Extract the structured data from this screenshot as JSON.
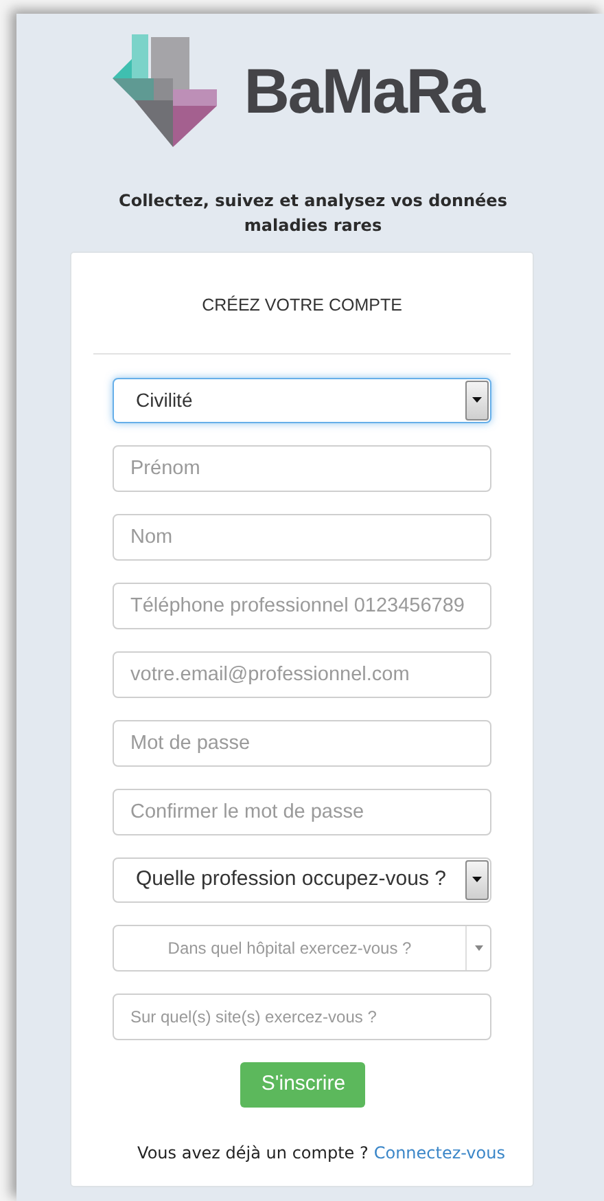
{
  "logo": {
    "text": "BaMaRa"
  },
  "tagline": "Collectez, suivez et analysez vos données maladies rares",
  "card": {
    "title": "CRÉEZ VOTRE COMPTE",
    "fields": [
      {
        "kind": "select",
        "value": "Civilité",
        "focused": true
      },
      {
        "kind": "input",
        "placeholder": "Prénom",
        "focused": false
      },
      {
        "kind": "input",
        "placeholder": "Nom",
        "focused": false
      },
      {
        "kind": "input",
        "placeholder": "Téléphone professionnel 0123456789",
        "focused": false
      },
      {
        "kind": "input",
        "placeholder": "votre.email@professionnel.com",
        "focused": false
      },
      {
        "kind": "input",
        "placeholder": "Mot de passe",
        "focused": false
      },
      {
        "kind": "input",
        "placeholder": "Confirmer le mot de passe",
        "focused": false
      },
      {
        "kind": "select",
        "value": "Quelle profession occupez-vous ?",
        "focused": false
      },
      {
        "kind": "combo",
        "placeholder": "Dans quel hôpital exercez-vous ?",
        "focused": false
      },
      {
        "kind": "tags",
        "placeholder": "Sur quel(s) site(s) exercez-vous ?",
        "focused": false
      }
    ],
    "submit": "S'inscrire",
    "footer": {
      "text": "Vous avez déjà un compte ?",
      "link": "Connectez-vous"
    }
  }
}
